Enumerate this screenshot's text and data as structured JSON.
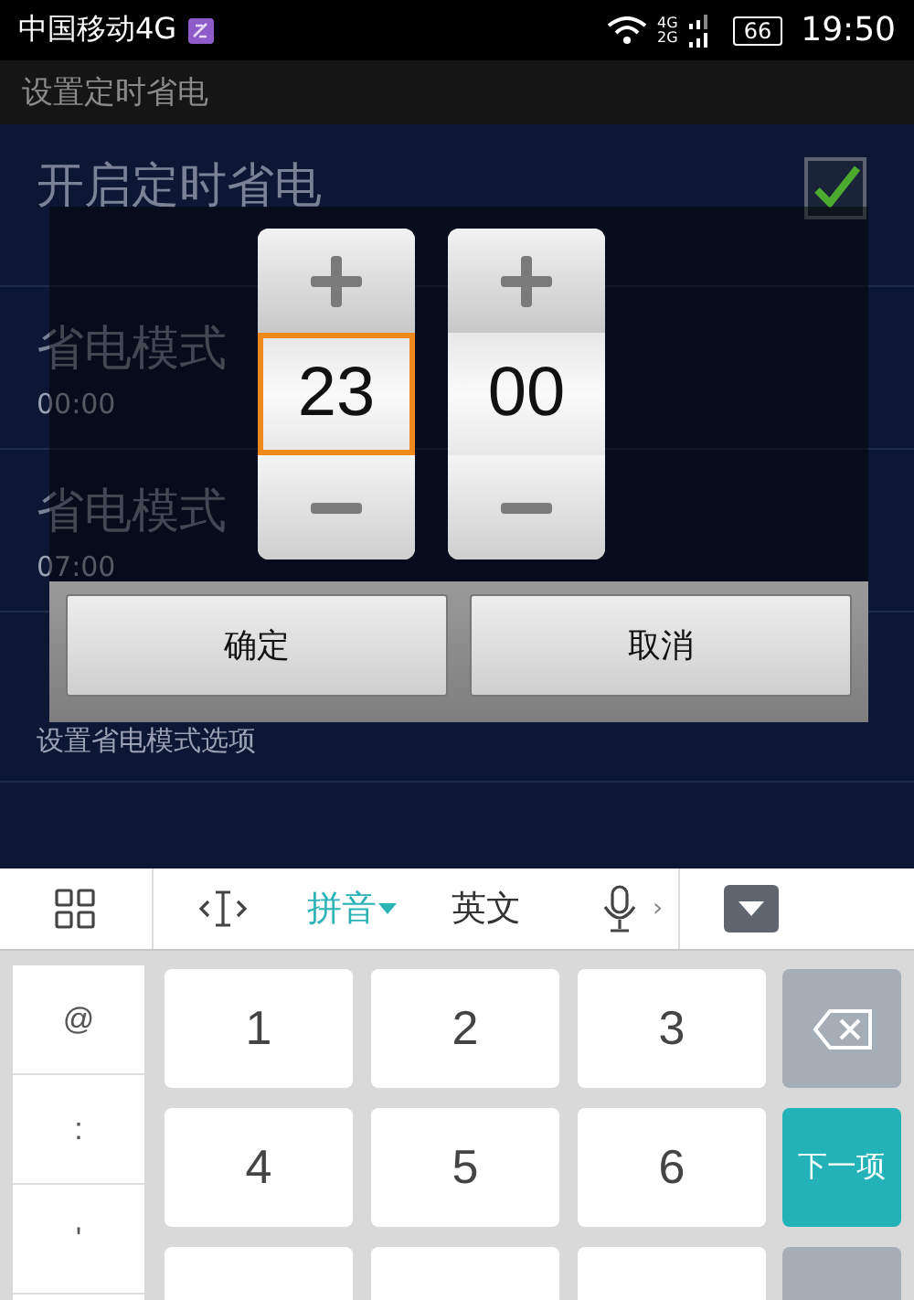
{
  "status_bar": {
    "carrier": "中国移动4G",
    "network_labels": [
      "4G",
      "2G"
    ],
    "battery": "66",
    "time": "19:50"
  },
  "title_bar": {
    "title": "设置定时省电"
  },
  "settings": [
    {
      "kind": "checkbox",
      "title": "开启定时省电",
      "checked": true
    },
    {
      "kind": "time",
      "title": "省电模式",
      "subtitle": "00:00"
    },
    {
      "kind": "time",
      "title": "省电模式",
      "subtitle": "07:00"
    },
    {
      "kind": "option",
      "subtitle": "设置省电模式选项"
    }
  ],
  "time_picker": {
    "columns": [
      {
        "value": "23",
        "selected": true
      },
      {
        "value": "00",
        "selected": false
      }
    ],
    "buttons": [
      "确定",
      "取消"
    ]
  },
  "keyboard": {
    "toolbar": [
      {
        "kind": "grid"
      },
      {
        "kind": "cursor"
      },
      {
        "kind": "text",
        "label": "拼音",
        "selected": true
      },
      {
        "kind": "text",
        "label": "英文",
        "selected": false
      },
      {
        "kind": "mic"
      },
      {
        "kind": "more",
        "label": "›"
      },
      {
        "kind": "hide"
      }
    ],
    "symbols": [
      "@",
      ":",
      "'"
    ],
    "keys": [
      {
        "kind": "digit",
        "label": "1"
      },
      {
        "kind": "digit",
        "label": "2"
      },
      {
        "kind": "digit",
        "label": "3"
      },
      {
        "kind": "digit",
        "label": "4"
      },
      {
        "kind": "digit",
        "label": "5"
      },
      {
        "kind": "digit",
        "label": "6"
      },
      {
        "kind": "blank"
      },
      {
        "kind": "blank"
      },
      {
        "kind": "blank"
      }
    ],
    "side_keys": [
      {
        "kind": "backspace"
      },
      {
        "kind": "action",
        "label": "下一项"
      },
      {
        "kind": "blank"
      }
    ]
  }
}
